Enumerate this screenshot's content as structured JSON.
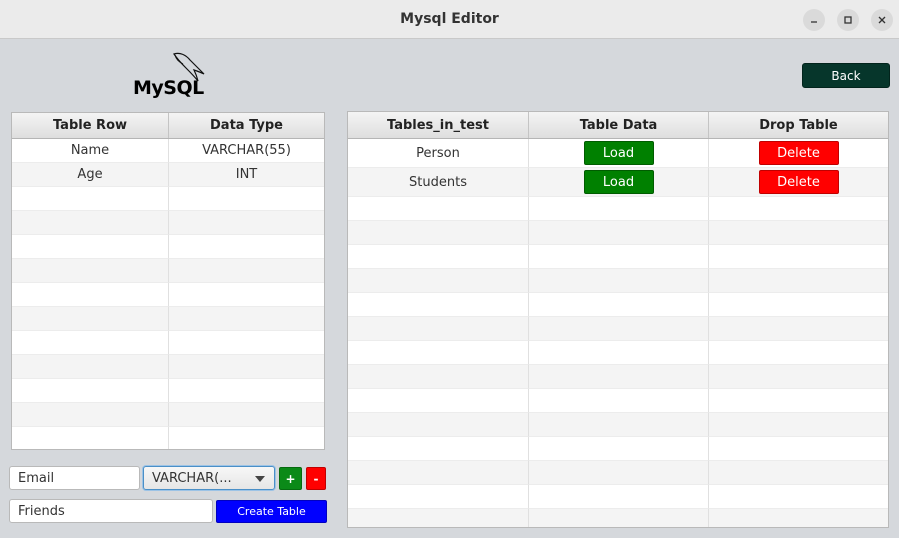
{
  "window": {
    "title": "Mysql Editor",
    "controls": [
      "minimize-icon",
      "maximize-icon",
      "close-icon"
    ]
  },
  "logo": {
    "text": "MySQL",
    "icon": "dolphin-icon"
  },
  "back_button": {
    "label": "Back"
  },
  "columns_table": {
    "headers": [
      "Table Row",
      "Data Type"
    ],
    "rows": [
      [
        "Name",
        "VARCHAR(55)"
      ],
      [
        "Age",
        "INT"
      ]
    ],
    "empty_rows": 11
  },
  "tables_table": {
    "headers": [
      "Tables_in_test",
      "Table Data",
      "Drop Table"
    ],
    "rows": [
      {
        "name": "Person",
        "load_label": "Load",
        "delete_label": "Delete"
      },
      {
        "name": "Students",
        "load_label": "Load",
        "delete_label": "Delete"
      }
    ],
    "empty_rows": 14
  },
  "column_form": {
    "column_name_value": "Email",
    "type_value": "VARCHAR(...",
    "add_label": "+",
    "remove_label": "-"
  },
  "table_form": {
    "table_name_value": "Friends",
    "create_label": "Create Table"
  },
  "colors": {
    "load": "#008000",
    "delete": "#ff0000",
    "create": "#0000ff",
    "back": "#06362b"
  }
}
